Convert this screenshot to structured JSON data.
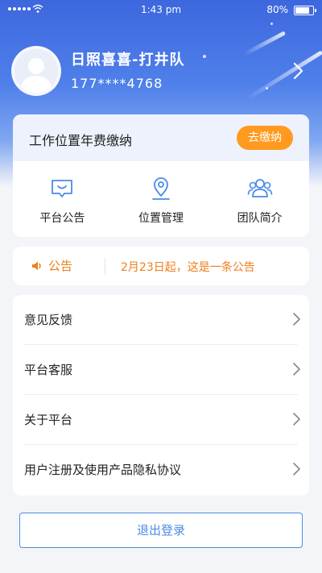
{
  "status_bar": {
    "time": "1:43 pm",
    "battery_percent": "80%",
    "battery_level": 0.8,
    "signal_dots": 5
  },
  "profile": {
    "name": "日照喜喜-打井队",
    "phone": "177****4768",
    "avatar_icon": "user-silhouette-icon",
    "arrow_icon": "chevron-right-icon"
  },
  "fee": {
    "title": "工作位置年费缴纳",
    "pay_label": "去缴纳",
    "pay_color": "#ff9a1e"
  },
  "shortcuts": [
    {
      "label": "平台公告",
      "icon": "announcement-icon"
    },
    {
      "label": "位置管理",
      "icon": "location-pin-icon"
    },
    {
      "label": "团队简介",
      "icon": "team-icon"
    }
  ],
  "notice": {
    "tag": "公告",
    "text": "2月23日起，这是一条公告",
    "icon": "speaker-icon",
    "color": "#ee7f1c"
  },
  "menu": [
    {
      "label": "意见反馈"
    },
    {
      "label": "平台客服"
    },
    {
      "label": "关于平台"
    },
    {
      "label": "用户注册及使用产品隐私协议"
    }
  ],
  "logout_label": "退出登录",
  "colors": {
    "primary": "#3d67de",
    "accent": "#4a8be8",
    "orange": "#ff9a1e"
  }
}
